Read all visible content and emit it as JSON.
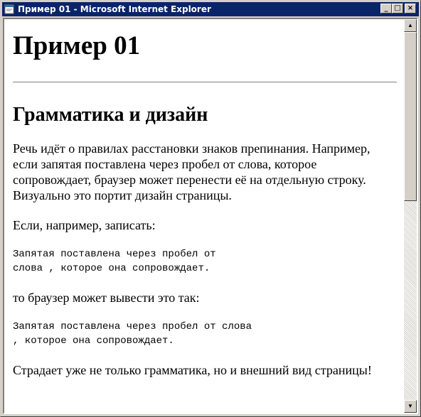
{
  "window": {
    "title": "Пример 01 - Microsoft Internet Explorer",
    "minimize_glyph": "_",
    "maximize_glyph": "□",
    "close_glyph": "×"
  },
  "page": {
    "heading": "Пример 01",
    "subheading": "Грамматика и дизайн",
    "paragraph1": "Речь идёт о правилах расстановки знаков препинания. Например, если запятая поставлена через пробел от слова, которое сопровождает, браузер может перенести её на отдельную строку. Визуально это портит дизайн страницы.",
    "paragraph2": "Если, например, записать:",
    "code1": "Запятая поставлена через пробел от\nслова , которое она сопровождает.",
    "paragraph3": "то браузер может вывести это так:",
    "code2": "Запятая поставлена через пробел от слова\n, которое она сопровождает.",
    "paragraph4": "Страдает уже не только грамматика, но и внешний вид страницы!"
  },
  "scrollbar": {
    "up_glyph": "▲",
    "down_glyph": "▼"
  },
  "colors": {
    "titlebar": "#0a246a",
    "chrome": "#d4d0c8",
    "page_background": "#ffffff"
  }
}
